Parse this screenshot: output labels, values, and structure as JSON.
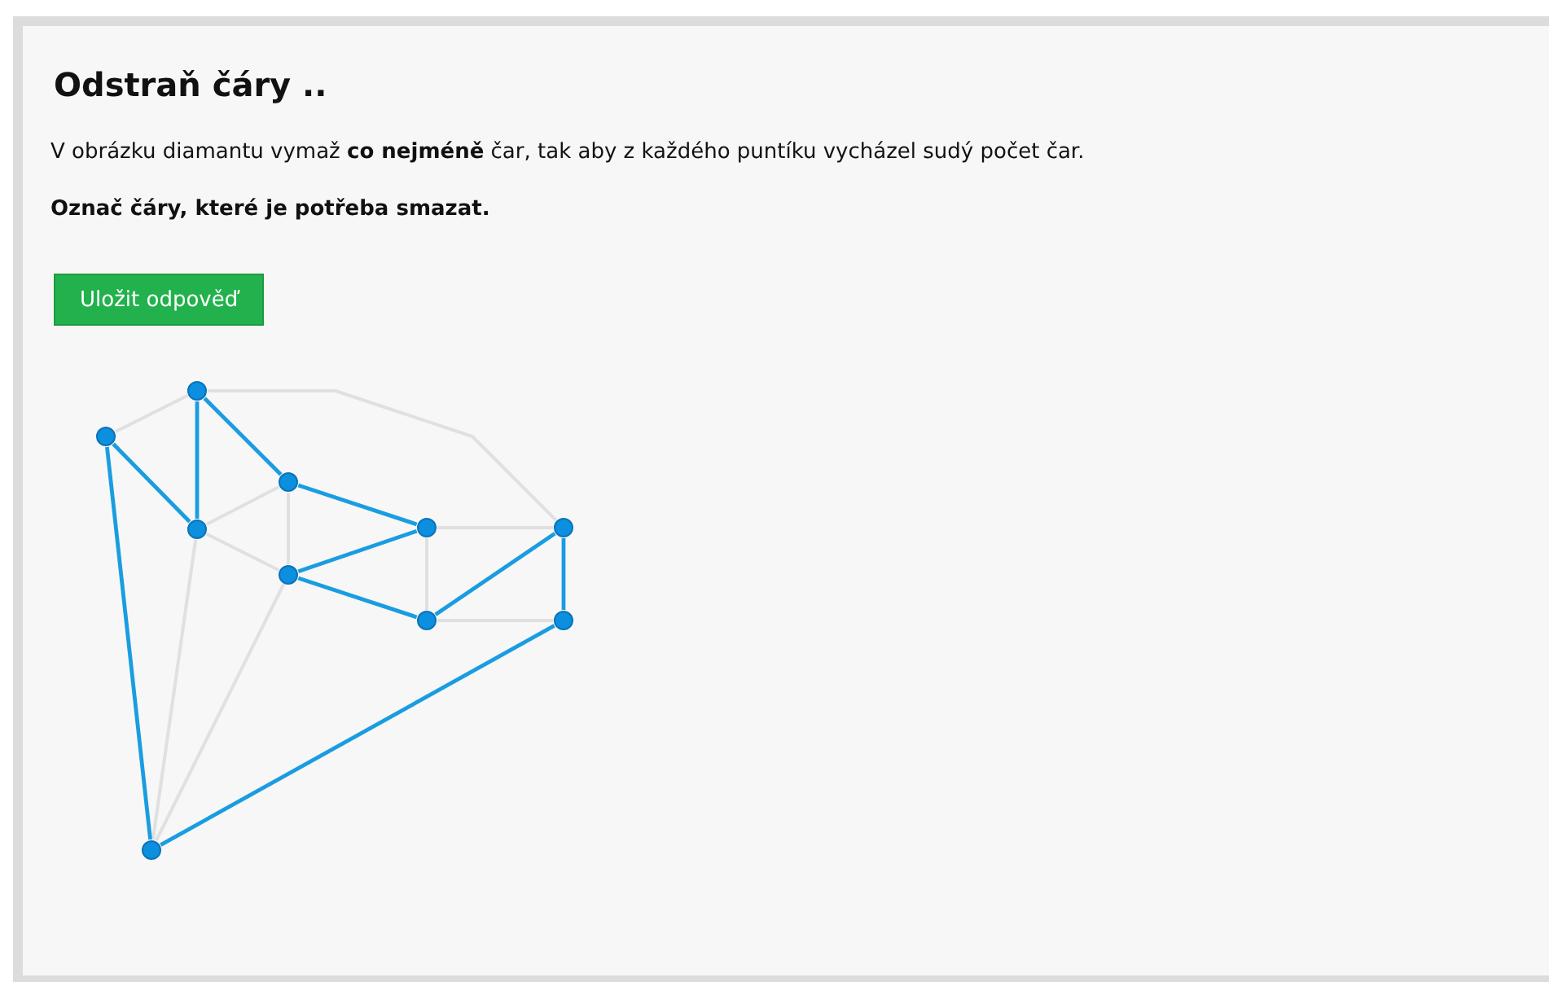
{
  "title": "Odstraň čáry ..",
  "instruction": "V obrázku diamantu vymaž **co nejméně** čar, tak aby z každého puntíku vycházel sudý počet čar.",
  "task": "Označ čáry, které je potřeba smazat.",
  "save_button": "Uložit odpověď",
  "edges": [
    {
      "selected": false
    },
    {
      "selected": false
    },
    {
      "selected": true
    },
    {
      "selected": true
    },
    {
      "selected": true
    },
    {
      "selected": false
    },
    {
      "selected": false
    },
    {
      "selected": false
    },
    {
      "selected": true
    },
    {
      "selected": true
    },
    {
      "selected": true
    },
    {
      "selected": false
    },
    {
      "selected": false
    },
    {
      "selected": true
    },
    {
      "selected": true
    },
    {
      "selected": false
    },
    {
      "selected": false
    },
    {
      "selected": false
    },
    {
      "selected": true
    },
    {
      "selected": true
    }
  ]
}
